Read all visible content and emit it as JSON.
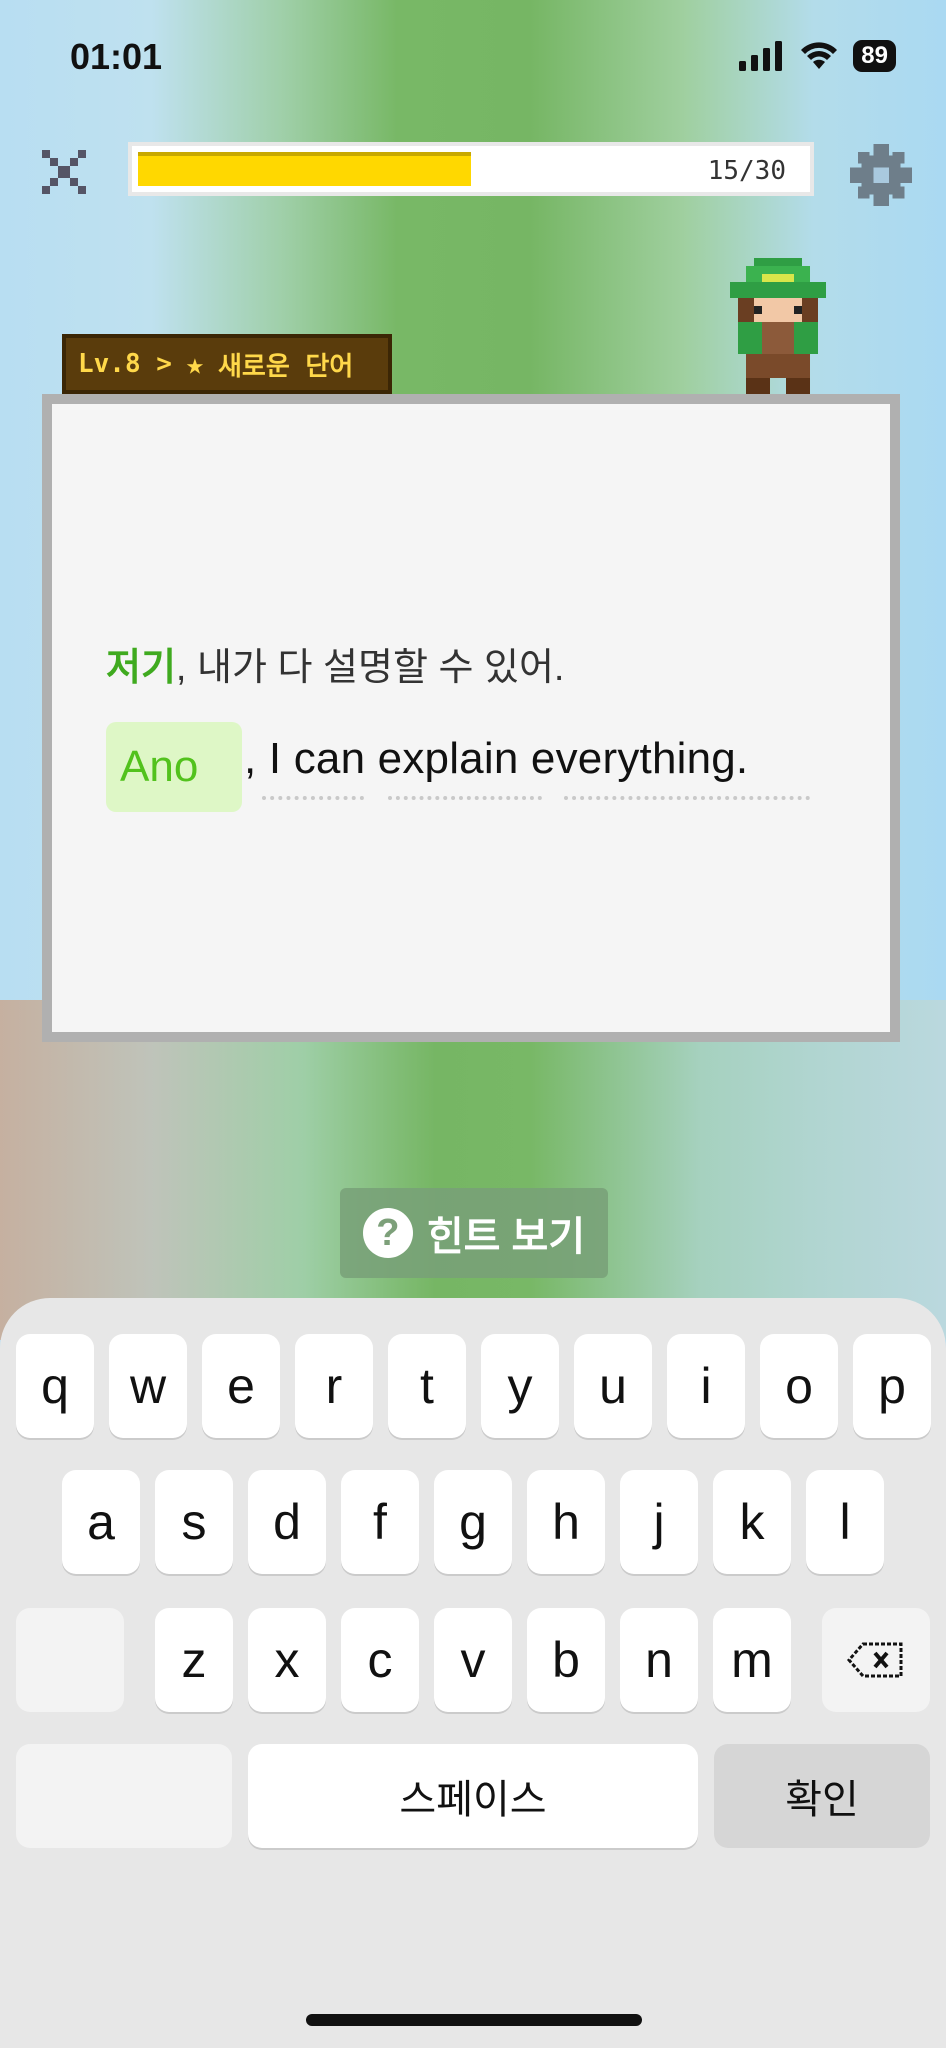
{
  "status_bar": {
    "time": "01:01",
    "battery": "89"
  },
  "progress": {
    "label": "15/30",
    "fraction": 0.5
  },
  "level_tag": {
    "level": "Lv.8 >",
    "title": "새로운 단어"
  },
  "card": {
    "korean_highlight": "저기",
    "korean_rest": ", 내가 다 설명할 수 있어.",
    "answer_typed": "Ano",
    "english_rest": ", I can explain everything."
  },
  "hint": {
    "label": "힌트 보기",
    "icon": "question-icon"
  },
  "keyboard": {
    "row1": [
      "q",
      "w",
      "e",
      "r",
      "t",
      "y",
      "u",
      "i",
      "o",
      "p"
    ],
    "row2": [
      "a",
      "s",
      "d",
      "f",
      "g",
      "h",
      "j",
      "k",
      "l"
    ],
    "row3": [
      "z",
      "x",
      "c",
      "v",
      "b",
      "n",
      "m"
    ],
    "space_label": "스페이스",
    "confirm_label": "확인"
  }
}
